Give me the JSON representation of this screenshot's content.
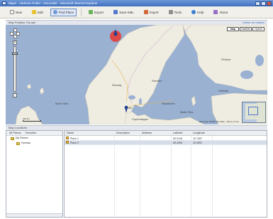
{
  "window": {
    "title": "Maps - Address Finder - Geocoder - Microsoft Internet Explorer"
  },
  "toolbar": {
    "buttons": [
      {
        "label": "New",
        "icon": "new-icon"
      },
      {
        "label": "Edit",
        "icon": "edit-icon"
      },
      {
        "label": "Find Place",
        "icon": "search-icon"
      },
      {
        "label": "Export",
        "icon": "export-icon"
      },
      {
        "label": "Save KML",
        "icon": "kml-icon"
      },
      {
        "label": "Import",
        "icon": "import-icon"
      },
      {
        "label": "Tools",
        "icon": "tools-icon"
      },
      {
        "label": "Help",
        "icon": "help-icon"
      },
      {
        "label": "About",
        "icon": "about-icon"
      }
    ]
  },
  "map": {
    "header_title": "Map Position: Europe",
    "header_right": "Center on marker",
    "type_buttons": [
      "Map",
      "Satellite",
      "Hybrid"
    ],
    "selected_type": "Map",
    "copyright": "Map data ©2008 Tele Atlas - Terms of Use",
    "scale_label": "200 km",
    "labels": {
      "norway": "Norway",
      "sweden": "Sweden",
      "finland": "Finland",
      "oslo": "Oslo",
      "stockholm": "Stockholm",
      "helsinki": "Helsinki",
      "copenhagen": "Copenhagen",
      "baltic": "Baltic Sea",
      "north_sea": "North Sea"
    }
  },
  "lower": {
    "header_title": "Map Locations"
  },
  "left_pane": {
    "tabs": [
      "All Places",
      "Favorites"
    ],
    "tree": [
      {
        "label": "My Places",
        "level": 0
      },
      {
        "label": "Norway",
        "level": 1
      }
    ]
  },
  "grid": {
    "columns": [
      "Name",
      "Description",
      "Address",
      "Latitude",
      "Longitude"
    ],
    "rows": [
      {
        "name": "Place 1",
        "description": "",
        "address": "",
        "latitude": "59.9138",
        "longitude": "10.7387"
      },
      {
        "name": "Place 2",
        "description": "",
        "address": "",
        "latitude": "63.4305",
        "longitude": "10.3951"
      }
    ]
  },
  "colors": {
    "water": "#9ab1d2",
    "land": "#efece1",
    "marker_red": "#e8362f",
    "marker_blue": "#1c3f94"
  }
}
